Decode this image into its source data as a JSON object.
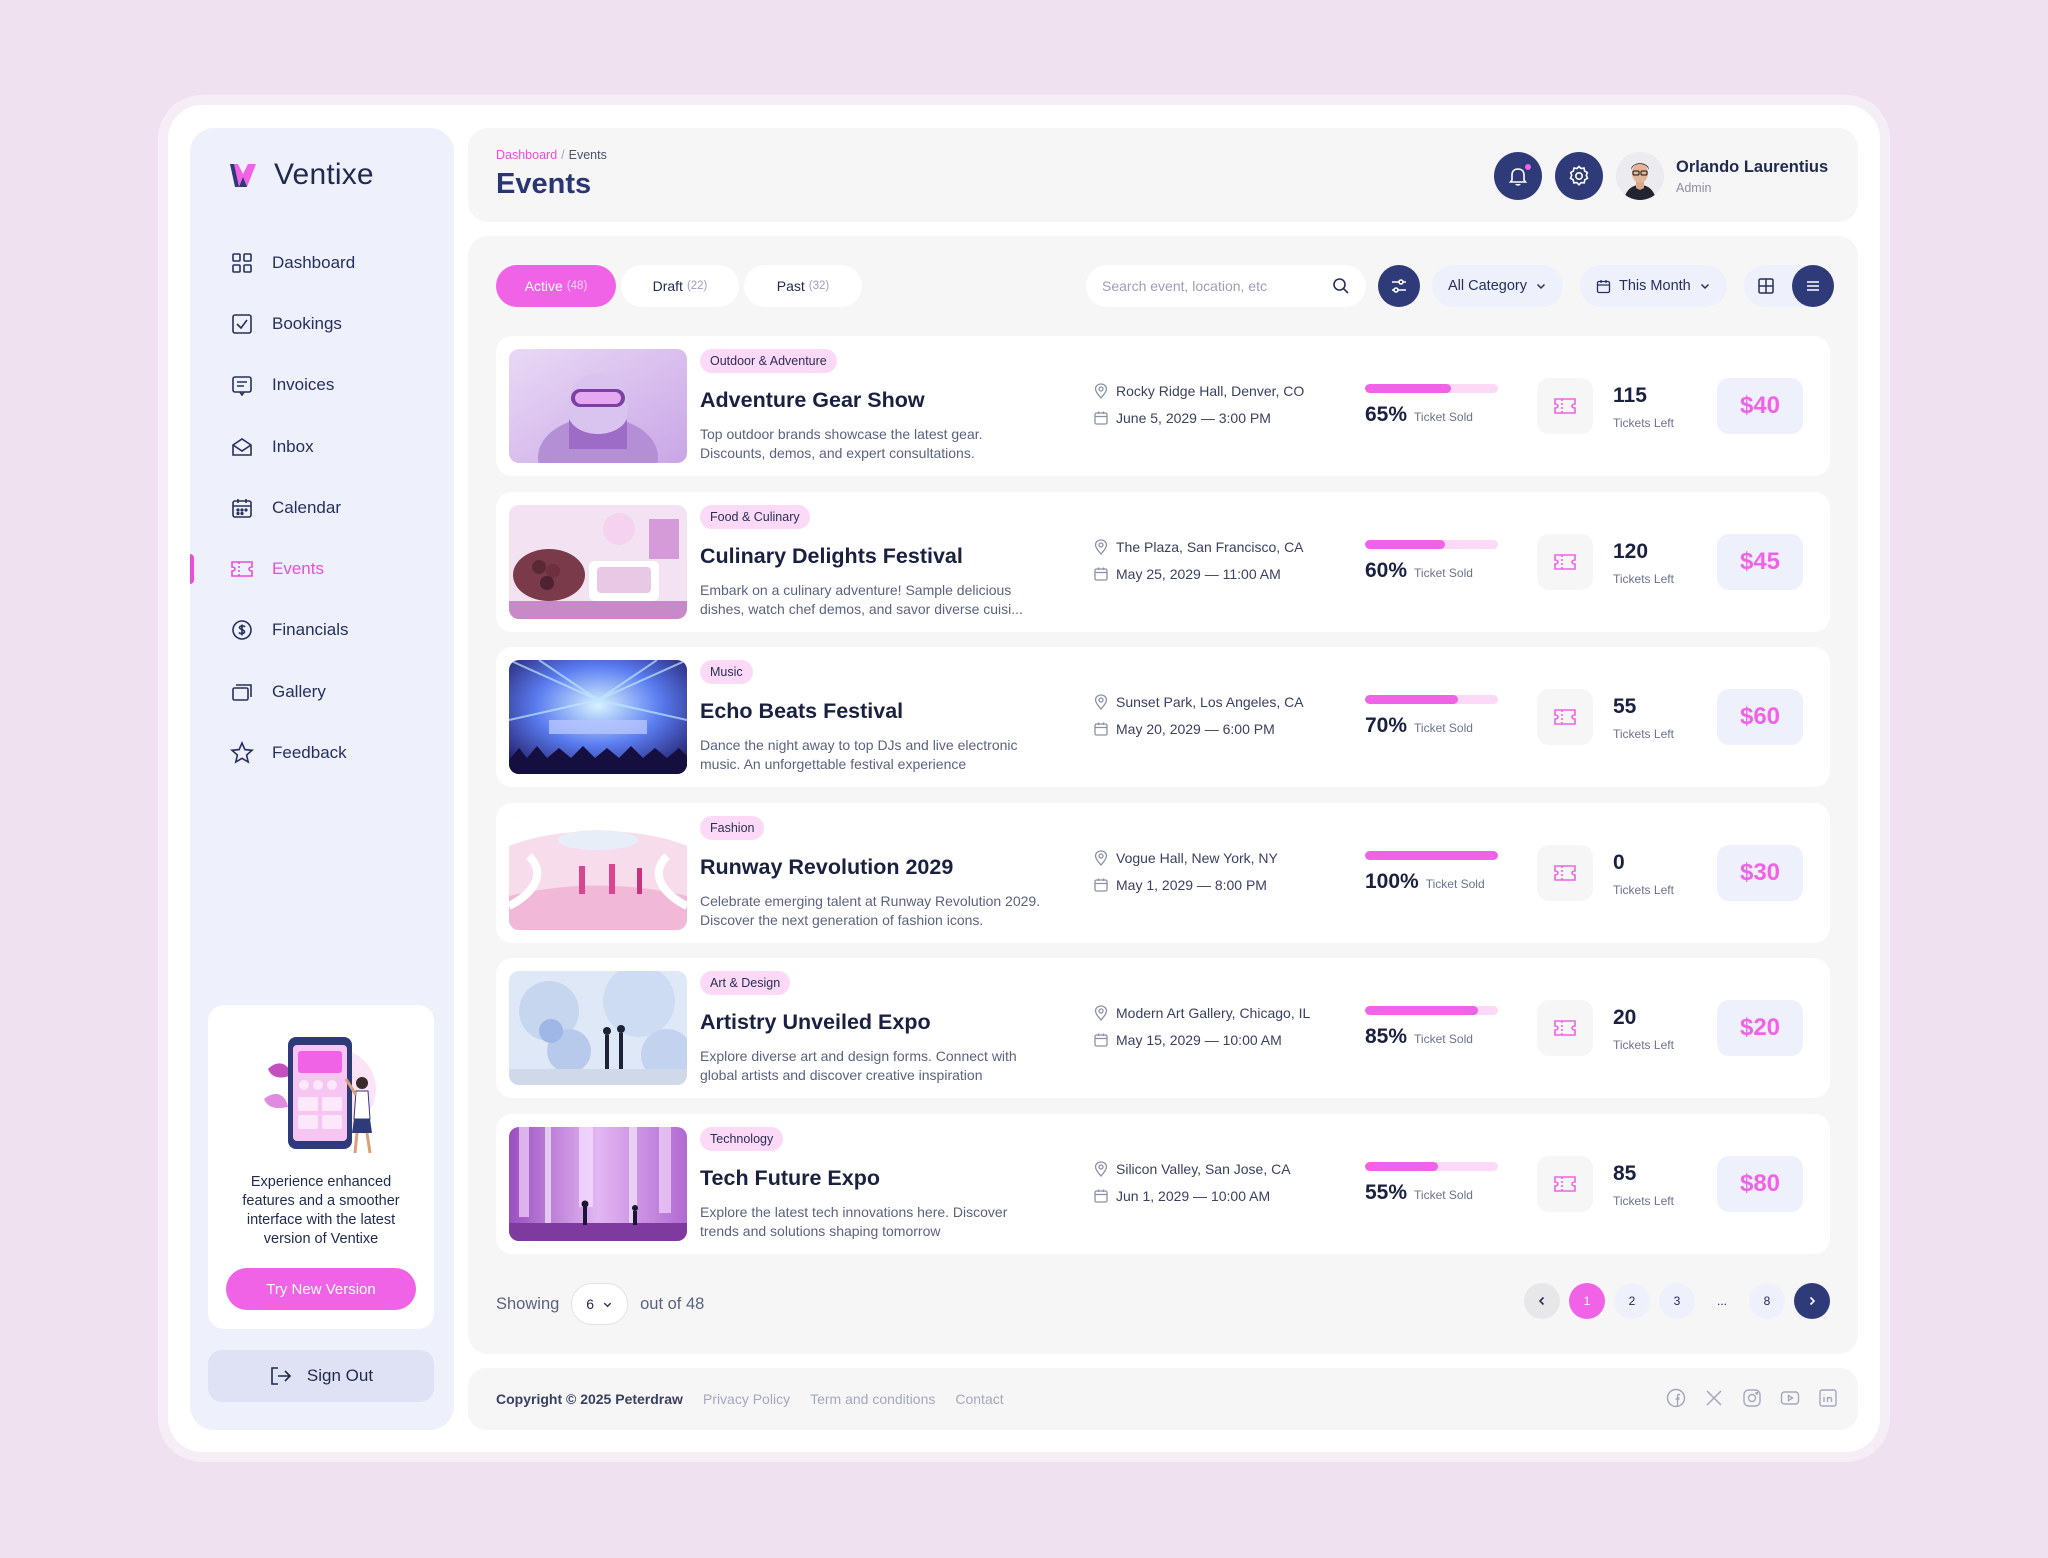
{
  "app": {
    "name": "Ventixe"
  },
  "sidebar": {
    "items": [
      {
        "label": "Dashboard",
        "icon": "dashboard-icon"
      },
      {
        "label": "Bookings",
        "icon": "bookings-icon"
      },
      {
        "label": "Invoices",
        "icon": "invoices-icon"
      },
      {
        "label": "Inbox",
        "icon": "inbox-icon"
      },
      {
        "label": "Calendar",
        "icon": "calendar-icon"
      },
      {
        "label": "Events",
        "icon": "ticket-icon",
        "active": true
      },
      {
        "label": "Financials",
        "icon": "dollar-icon"
      },
      {
        "label": "Gallery",
        "icon": "gallery-icon"
      },
      {
        "label": "Feedback",
        "icon": "star-icon"
      }
    ],
    "promo": {
      "text": "Experience enhanced features and a smoother interface with the latest version of Ventixe",
      "button": "Try New Version"
    },
    "signout": "Sign Out"
  },
  "header": {
    "breadcrumb": {
      "parent": "Dashboard",
      "sep": "/",
      "current": "Events"
    },
    "title": "Events",
    "user": {
      "name": "Orlando Laurentius",
      "role": "Admin"
    }
  },
  "toolbar": {
    "tabs": [
      {
        "label": "Active",
        "count": "(48)",
        "active": true
      },
      {
        "label": "Draft",
        "count": "(22)"
      },
      {
        "label": "Past",
        "count": "(32)"
      }
    ],
    "search_placeholder": "Search event, location, etc",
    "category": "All Category",
    "period": "This Month"
  },
  "events": [
    {
      "category": "Outdoor & Adventure",
      "title": "Adventure Gear Show",
      "desc": "Top outdoor brands showcase the latest gear. Discounts, demos, and expert consultations.",
      "location": "Rocky Ridge Hall, Denver, CO",
      "date": "June 5, 2029 — 3:00 PM",
      "sold_pct": 65,
      "sold_label": "65%",
      "sold_text": "Ticket Sold",
      "tickets_left": "115",
      "tickets_text": "Tickets Left",
      "price": "$40",
      "theme": "gear"
    },
    {
      "category": "Food & Culinary",
      "title": "Culinary Delights Festival",
      "desc": "Embark on a culinary adventure! Sample delicious dishes, watch chef demos, and savor diverse cuisi...",
      "location": "The Plaza, San Francisco, CA",
      "date": "May 25, 2029 — 11:00 AM",
      "sold_pct": 60,
      "sold_label": "60%",
      "sold_text": "Ticket Sold",
      "tickets_left": "120",
      "tickets_text": "Tickets Left",
      "price": "$45",
      "theme": "food"
    },
    {
      "category": "Music",
      "title": "Echo Beats Festival",
      "desc": "Dance the night away to top DJs and live electronic music. An unforgettable festival experience",
      "location": "Sunset Park, Los Angeles, CA",
      "date": "May 20, 2029 — 6:00 PM",
      "sold_pct": 70,
      "sold_label": "70%",
      "sold_text": "Ticket Sold",
      "tickets_left": "55",
      "tickets_text": "Tickets Left",
      "price": "$60",
      "theme": "music"
    },
    {
      "category": "Fashion",
      "title": "Runway Revolution 2029",
      "desc": "Celebrate emerging talent at Runway Revolution 2029. Discover the next generation of fashion icons.",
      "location": "Vogue Hall, New York, NY",
      "date": "May 1, 2029 — 8:00 PM",
      "sold_pct": 100,
      "sold_label": "100%",
      "sold_text": "Ticket Sold",
      "tickets_left": "0",
      "tickets_text": "Tickets Left",
      "price": "$30",
      "theme": "fashion"
    },
    {
      "category": "Art & Design",
      "title": "Artistry Unveiled Expo",
      "desc": "Explore diverse art and design forms. Connect with global artists and discover creative inspiration",
      "location": "Modern Art Gallery, Chicago, IL",
      "date": "May 15, 2029 — 10:00 AM",
      "sold_pct": 85,
      "sold_label": "85%",
      "sold_text": "Ticket Sold",
      "tickets_left": "20",
      "tickets_text": "Tickets Left",
      "price": "$20",
      "theme": "art"
    },
    {
      "category": "Technology",
      "title": "Tech Future Expo",
      "desc": "Explore the latest tech innovations here. Discover trends and solutions shaping tomorrow",
      "location": "Silicon Valley, San Jose, CA",
      "date": "Jun 1, 2029 — 10:00 AM",
      "sold_pct": 55,
      "sold_label": "55%",
      "sold_text": "Ticket Sold",
      "tickets_left": "85",
      "tickets_text": "Tickets Left",
      "price": "$80",
      "theme": "tech"
    }
  ],
  "pagination": {
    "showing": "Showing",
    "per_page": "6",
    "out_of": "out of 48",
    "pages": [
      "1",
      "2",
      "3",
      "...",
      "8"
    ],
    "current": "1"
  },
  "footer": {
    "copyright": "Copyright © 2025 Peterdraw",
    "links": [
      "Privacy Policy",
      "Term and conditions",
      "Contact"
    ],
    "socials": [
      "facebook-icon",
      "x-icon",
      "instagram-icon",
      "youtube-icon",
      "linkedin-icon"
    ]
  },
  "colors": {
    "accent": "#f062e6",
    "navy": "#2f3a78",
    "bg": "#efe1ef"
  }
}
